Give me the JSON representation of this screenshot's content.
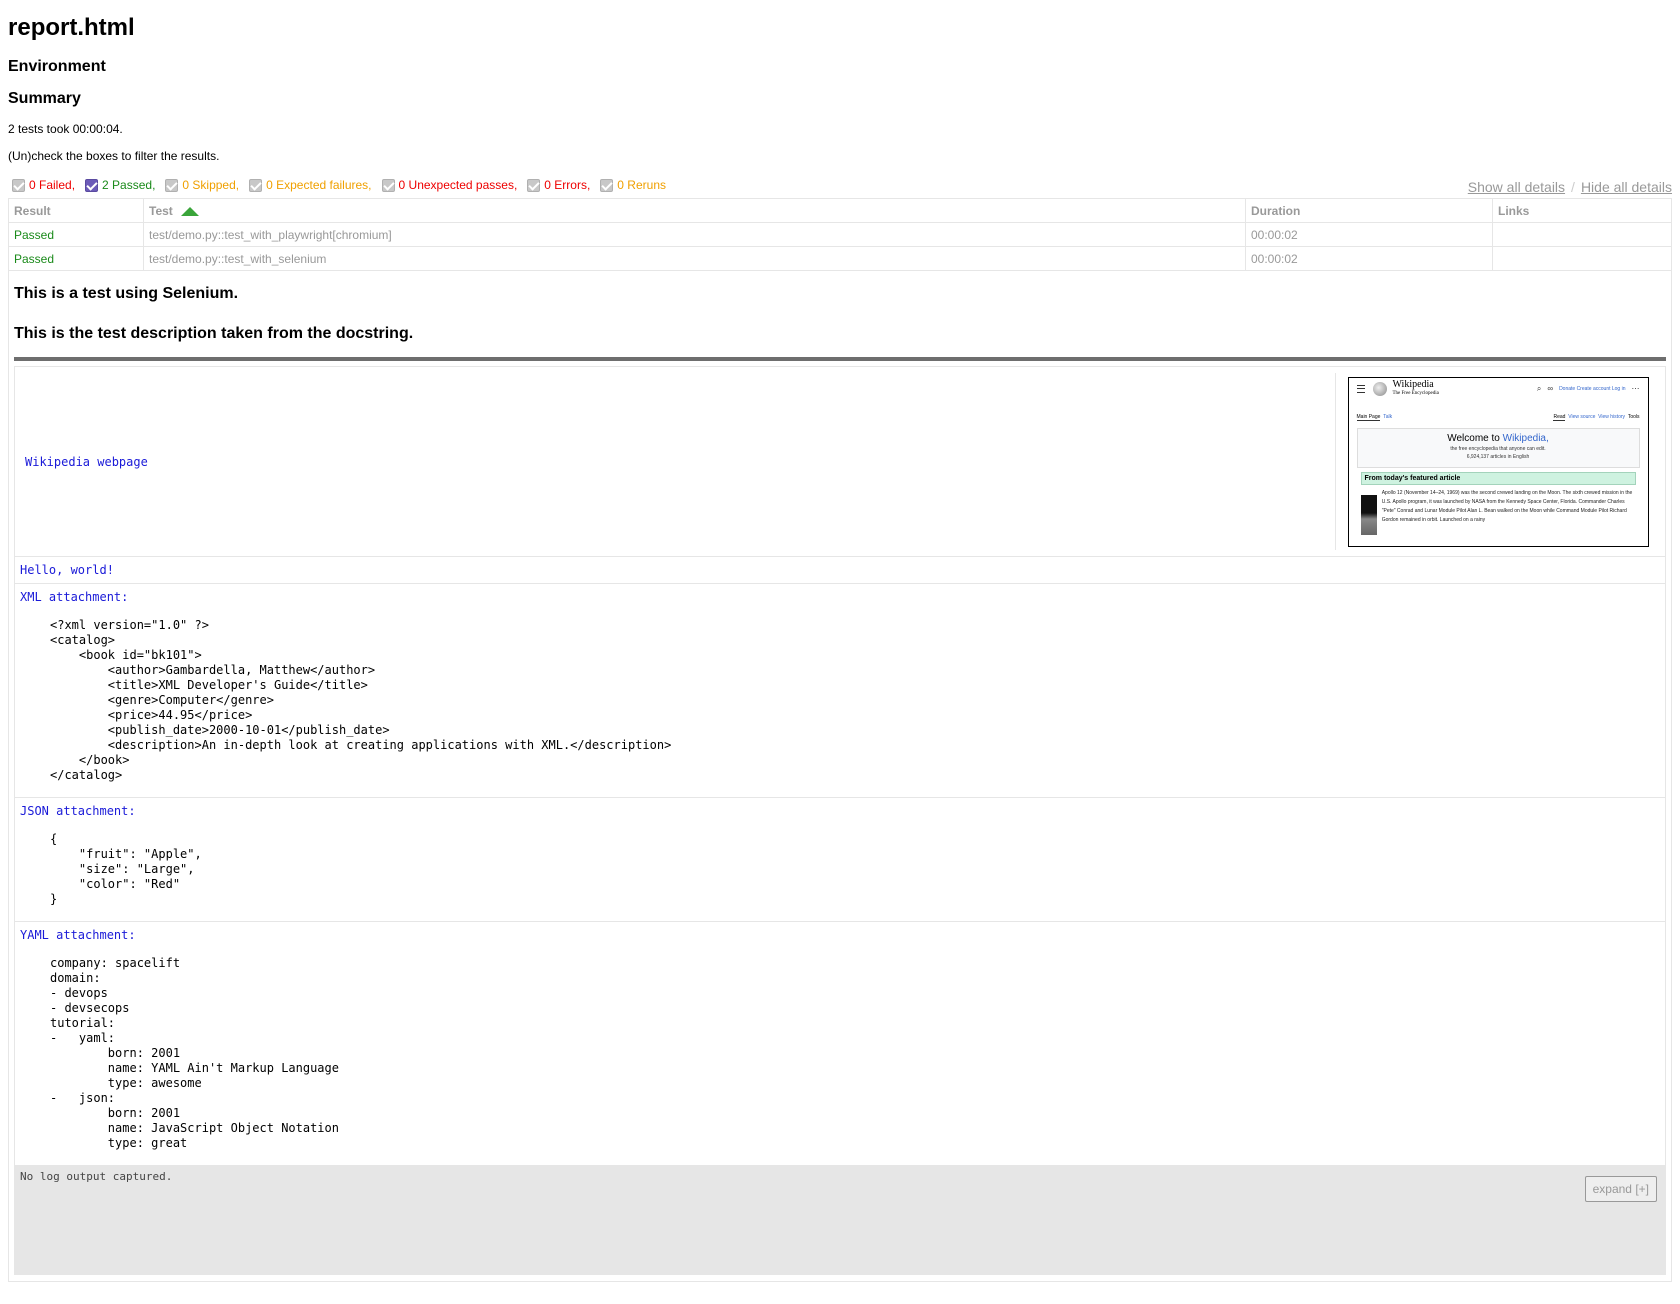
{
  "page": {
    "title": "report.html",
    "environment_heading": "Environment",
    "summary_heading": "Summary",
    "summary_text": "2 tests took 00:00:04.",
    "filter_hint": "(Un)check the boxes to filter the results."
  },
  "filters": [
    {
      "label": "0 Failed,",
      "color": "#e00000",
      "checked": true
    },
    {
      "label": "2 Passed,",
      "color": "#1a8a1a",
      "checked": true
    },
    {
      "label": "0 Skipped,",
      "color": "#f0a000",
      "checked": true
    },
    {
      "label": "0 Expected failures,",
      "color": "#f0a000",
      "checked": true
    },
    {
      "label": "0 Unexpected passes,",
      "color": "#e00000",
      "checked": true
    },
    {
      "label": "0 Errors,",
      "color": "#e00000",
      "checked": true
    },
    {
      "label": "0 Reruns",
      "color": "#f0a000",
      "checked": true
    }
  ],
  "details_links": {
    "show": "Show all details",
    "separator": "/",
    "hide": "Hide all details"
  },
  "table": {
    "headers": {
      "result": "Result",
      "test": "Test",
      "duration": "Duration",
      "links": "Links"
    },
    "rows": [
      {
        "result": "Passed",
        "test": "test/demo.py::test_with_playwright[chromium]",
        "duration": "00:00:02",
        "links": ""
      },
      {
        "result": "Passed",
        "test": "test/demo.py::test_with_selenium",
        "duration": "00:00:02",
        "links": ""
      }
    ]
  },
  "details": {
    "desc1": "This is a test using Selenium.",
    "desc2": "This is the test description taken from the docstring.",
    "wiki_label": "Wikipedia webpage",
    "hello": "Hello, world!",
    "xml_label": "XML attachment:",
    "xml_code": "<?xml version=\"1.0\" ?>\n<catalog>\n    <book id=\"bk101\">\n        <author>Gambardella, Matthew</author>\n        <title>XML Developer's Guide</title>\n        <genre>Computer</genre>\n        <price>44.95</price>\n        <publish_date>2000-10-01</publish_date>\n        <description>An in-depth look at creating applications with XML.</description>\n    </book>\n</catalog>",
    "json_label": "JSON attachment:",
    "json_code": "{\n    \"fruit\": \"Apple\",\n    \"size\": \"Large\",\n    \"color\": \"Red\"\n}",
    "yaml_label": "YAML attachment:",
    "yaml_code": "company: spacelift\ndomain:\n- devops\n- devsecops\ntutorial:\n-   yaml:\n        born: 2001\n        name: YAML Ain't Markup Language\n        type: awesome\n-   json:\n        born: 2001\n        name: JavaScript Object Notation\n        type: great",
    "log_text": "No log output captured.",
    "expand_label": "expand [+]"
  },
  "wiki_thumb": {
    "name": "Wikipedia",
    "tagline": "The Free Encyclopedia",
    "top_links": "Donate  Create account  Log in",
    "tab_main": "Main Page",
    "tab_talk": "Talk",
    "tab_read": "Read",
    "tab_view_source": "View source",
    "tab_view_history": "View history",
    "tab_tools": "Tools",
    "welcome_prefix": "Welcome to ",
    "welcome_link": "Wikipedia,",
    "welcome_sub": "the free encyclopedia that anyone can edit.",
    "article_count": "6,924,137 articles in English",
    "featured_heading": "From today's featured article",
    "featured_text": "Apollo 12 (November 14–24, 1969) was the second crewed landing on the Moon. The sixth crewed mission in the U.S. Apollo program, it was launched by NASA from the Kennedy Space Center, Florida. Commander Charles \"Pete\" Conrad and Lunar Module Pilot Alan L. Bean walked on the Moon while Command Module Pilot Richard Gordon remained in orbit. Launched on a rainy"
  }
}
